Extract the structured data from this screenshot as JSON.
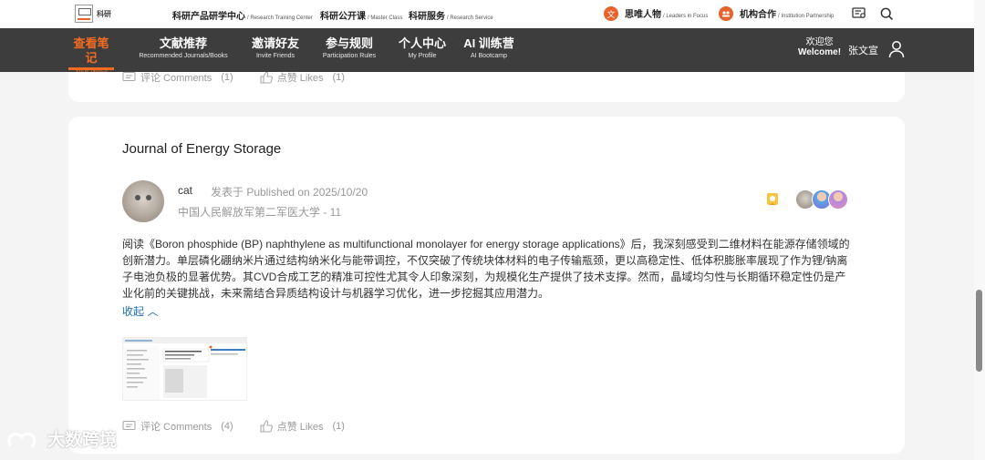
{
  "header": {
    "logo_text": "科研",
    "links": [
      {
        "cn": "科研产品研学中心",
        "en": "/ Research Training Center"
      },
      {
        "cn": "科研公开课",
        "en": "/ Master Class"
      },
      {
        "cn": "科研服务",
        "en": "/ Research Service"
      }
    ],
    "right_links": [
      {
        "cn": "思唯人物",
        "en": "/ Leaders in Focus"
      },
      {
        "cn": "机构合作",
        "en": "/ Institution Partnership"
      }
    ]
  },
  "nav": {
    "items": [
      {
        "cn": "查看笔记",
        "en": "View Notes",
        "active": true
      },
      {
        "cn": "文献推荐",
        "en": "Recommended Journals/Books"
      },
      {
        "cn": "邀请好友",
        "en": "Invite Friends"
      },
      {
        "cn": "参与规则",
        "en": "Participation Rules"
      },
      {
        "cn": "个人中心",
        "en": "My Profile"
      },
      {
        "cn": "AI 训练营",
        "en": "AI Bootcamp"
      }
    ],
    "welcome_cn": "欢迎您",
    "welcome_en": "Welcome!",
    "username": "张文宣"
  },
  "prev_post": {
    "comments_label": "评论 Comments",
    "comments_count": "(1)",
    "likes_label": "点赞 Likes",
    "likes_count": "(1)"
  },
  "post": {
    "journal": "Journal of Energy Storage",
    "author": "cat",
    "published": "发表于 Published on 2025/10/20",
    "affiliation": "中国人民解放军第二军医大学 - 11",
    "body": "阅读《Boron phosphide (BP) naphthylene as multifunctional monolayer for energy storage applications》后，我深刻感受到二维材料在能源存储领域的创新潜力。单层磷化硼纳米片通过结构纳米化与能带调控，不仅突破了传统块体材料的电子传输瓶颈，更以高稳定性、低体积膨胀率展现了作为锂/钠离子电池负极的显著优势。其CVD合成工艺的精准可控性尤其令人印象深刻，为规模化生产提供了技术支撑。然而，晶域均匀性与长期循环稳定性仍是产业化前的关键挑战，未来需结合异质结构设计与机器学习优化，进一步挖掘其应用潜力。",
    "collapse_label": "收起 ︿",
    "comments_label": "评论 Comments",
    "comments_count": "(4)",
    "likes_label": "点赞 Likes",
    "likes_count": "(1)"
  },
  "watermark": "大数跨境",
  "colors": {
    "accent": "#f26b21",
    "nav_bg": "#3d3d3d",
    "link": "#1d6fb8"
  }
}
